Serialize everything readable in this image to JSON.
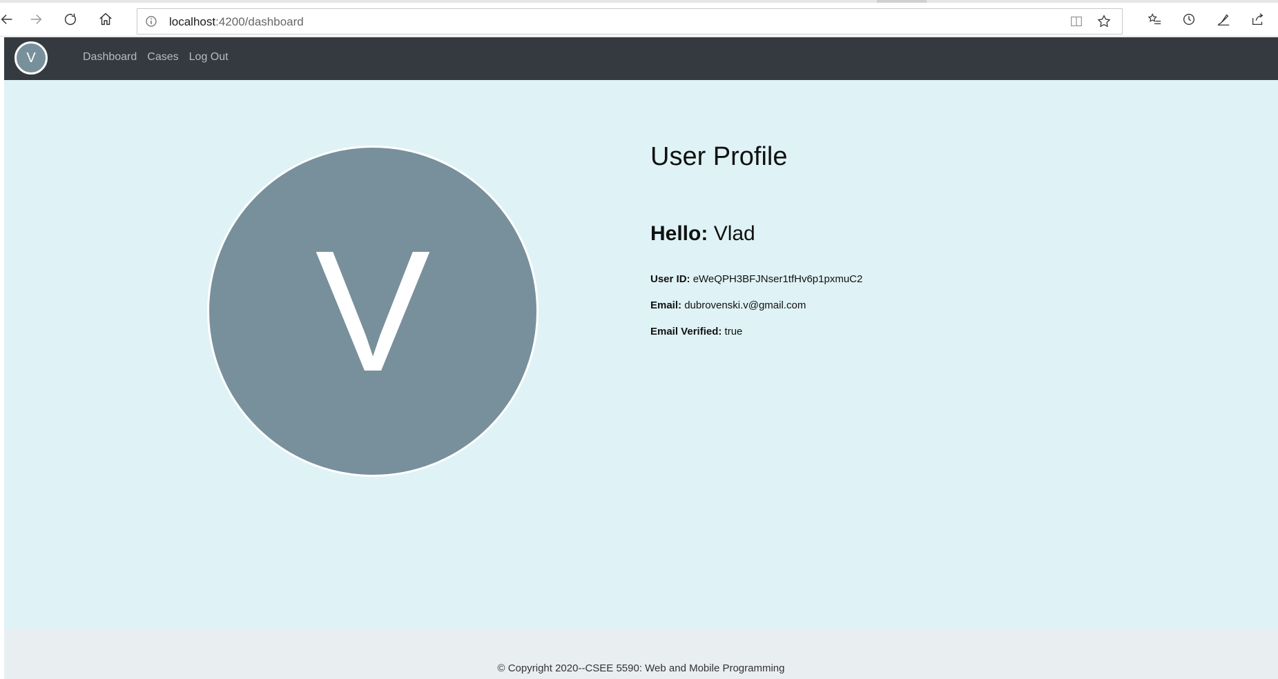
{
  "browser": {
    "url_host": "localhost",
    "url_path": ":4200/dashboard",
    "icons": {
      "back": "back-arrow-icon",
      "forward": "forward-arrow-icon",
      "refresh": "refresh-icon",
      "home": "home-icon",
      "info": "info-icon",
      "reading_view": "reading-view-icon",
      "favorite": "star-icon",
      "favorites_list": "favorites-list-icon",
      "history": "history-icon",
      "notes": "pen-icon",
      "share": "share-icon"
    }
  },
  "navbar": {
    "avatar_initial": "V",
    "links": [
      {
        "label": "Dashboard"
      },
      {
        "label": "Cases"
      },
      {
        "label": "Log Out"
      }
    ],
    "bg_color": "#343a40"
  },
  "profile": {
    "avatar_initial": "V",
    "title": "User Profile",
    "hello_label": "Hello:",
    "hello_name": "Vlad",
    "fields": [
      {
        "label": "User ID:",
        "value": "eWeQPH3BFJNser1tfHv6p1pxmuC2"
      },
      {
        "label": "Email:",
        "value": "dubrovenski.v@gmail.com"
      },
      {
        "label": "Email Verified:",
        "value": "true"
      }
    ],
    "avatar_color": "#78909c",
    "bg_color": "#dff2f5"
  },
  "footer": {
    "text": "© Copyright 2020--CSEE 5590: Web and Mobile Programming"
  }
}
